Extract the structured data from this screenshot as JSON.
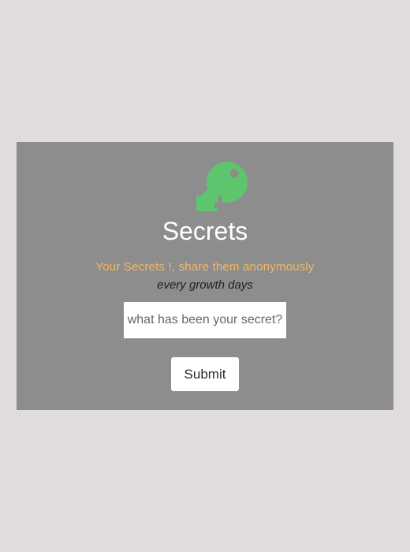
{
  "card": {
    "icon": "key-icon",
    "icon_color": "#5ec46e",
    "title": "Secrets",
    "tagline": "Your Secrets !, share them anonymously",
    "subtagline": "every growth days",
    "tagline_color": "#f4b860"
  },
  "form": {
    "secret_placeholder": "what has been your secret?",
    "secret_value": "",
    "submit_label": "Submit"
  },
  "colors": {
    "page_background": "#e0dcdb",
    "card_background": "#8d8d8d"
  }
}
